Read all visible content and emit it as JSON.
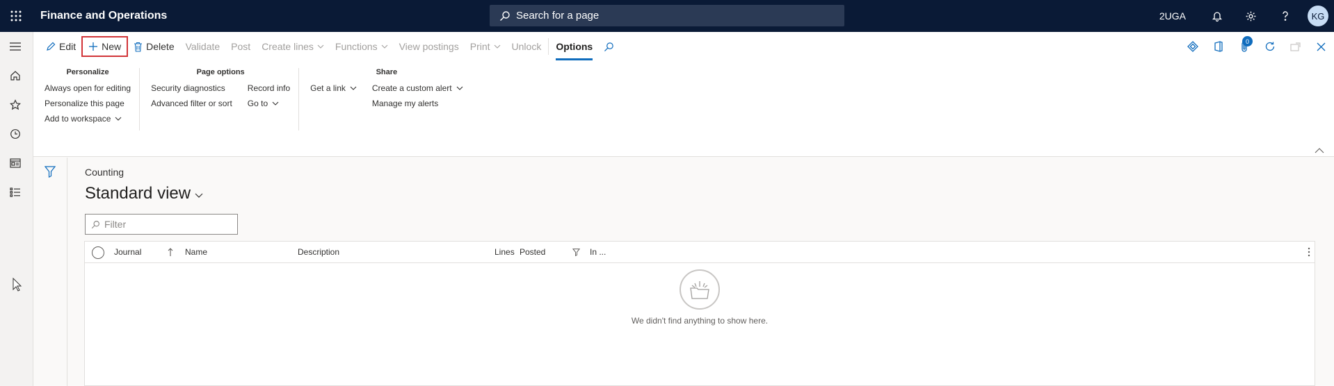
{
  "header": {
    "app_title": "Finance and Operations",
    "search_placeholder": "Search for a page",
    "company": "2UGA",
    "user_initials": "KG"
  },
  "actionbar": {
    "edit": "Edit",
    "new": "New",
    "delete": "Delete",
    "validate": "Validate",
    "post": "Post",
    "create_lines": "Create lines",
    "functions": "Functions",
    "view_postings": "View postings",
    "print": "Print",
    "unlock": "Unlock",
    "options": "Options",
    "notification_count": "0"
  },
  "options_groups": {
    "personalize": {
      "title": "Personalize",
      "items": [
        "Always open for editing",
        "Personalize this page",
        "Add to workspace"
      ]
    },
    "page_options": {
      "title": "Page options",
      "items": [
        "Security diagnostics",
        "Advanced filter or sort",
        "Record info",
        "Go to"
      ]
    },
    "share": {
      "title": "Share",
      "items": [
        "Get a link",
        "Create a custom alert",
        "Manage my alerts"
      ]
    }
  },
  "page": {
    "caption": "Counting",
    "view_name": "Standard view",
    "filter_placeholder": "Filter"
  },
  "grid": {
    "columns": [
      "Journal",
      "Name",
      "Description",
      "Lines",
      "Posted",
      "In ..."
    ],
    "empty_message": "We didn't find anything to show here."
  }
}
